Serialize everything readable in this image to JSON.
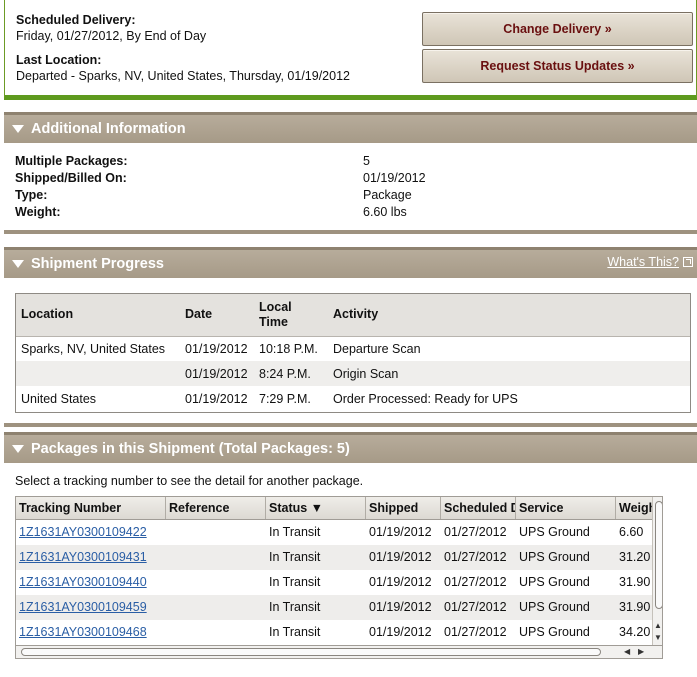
{
  "delivery": {
    "scheduled_label": "Scheduled Delivery:",
    "scheduled_value": "Friday, 01/27/2012, By End of Day",
    "last_location_label": "Last Location:",
    "last_location_value": "Departed - Sparks, NV, United States, Thursday, 01/19/2012",
    "change_button": "Change Delivery »",
    "request_button": "Request Status Updates »"
  },
  "additional_info": {
    "title": "Additional Information",
    "rows": [
      {
        "label": "Multiple Packages:",
        "value": "5"
      },
      {
        "label": "Shipped/Billed On:",
        "value": "01/19/2012"
      },
      {
        "label": "Type:",
        "value": "Package"
      },
      {
        "label": "Weight:",
        "value": "6.60 lbs"
      }
    ]
  },
  "progress": {
    "title": "Shipment Progress",
    "whats_this": "What's This?",
    "columns": [
      "Location",
      "Date",
      "Local Time",
      "Activity"
    ],
    "rows": [
      {
        "location": "Sparks, NV, United States",
        "date": "01/19/2012",
        "time": "10:18 P.M.",
        "activity": "Departure Scan"
      },
      {
        "location": "",
        "date": "01/19/2012",
        "time": "8:24 P.M.",
        "activity": "Origin Scan"
      },
      {
        "location": "United States",
        "date": "01/19/2012",
        "time": "7:29 P.M.",
        "activity": "Order Processed: Ready for UPS"
      }
    ]
  },
  "packages": {
    "title": "Packages in this Shipment (Total Packages: 5)",
    "note": "Select a tracking number to see the detail for another package.",
    "columns": [
      "Tracking Number",
      "Reference",
      "Status ▼",
      "Shipped",
      "Scheduled Delivery",
      "Service",
      "Weight"
    ],
    "rows": [
      {
        "tracking": "1Z1631AY0300109422",
        "reference": "",
        "status": "In Transit",
        "shipped": "01/19/2012",
        "scheduled": "01/27/2012",
        "service": "UPS Ground",
        "weight": "6.60"
      },
      {
        "tracking": "1Z1631AY0300109431",
        "reference": "",
        "status": "In Transit",
        "shipped": "01/19/2012",
        "scheduled": "01/27/2012",
        "service": "UPS Ground",
        "weight": "31.20"
      },
      {
        "tracking": "1Z1631AY0300109440",
        "reference": "",
        "status": "In Transit",
        "shipped": "01/19/2012",
        "scheduled": "01/27/2012",
        "service": "UPS Ground",
        "weight": "31.90"
      },
      {
        "tracking": "1Z1631AY0300109459",
        "reference": "",
        "status": "In Transit",
        "shipped": "01/19/2012",
        "scheduled": "01/27/2012",
        "service": "UPS Ground",
        "weight": "31.90"
      },
      {
        "tracking": "1Z1631AY0300109468",
        "reference": "",
        "status": "In Transit",
        "shipped": "01/19/2012",
        "scheduled": "01/27/2012",
        "service": "UPS Ground",
        "weight": "34.20"
      }
    ]
  },
  "colors": {
    "accent_green": "#5e9a1e",
    "header_tan": "#a69a87",
    "button_text": "#6a1010",
    "link": "#2a5ea5"
  },
  "icons": {
    "section_toggle": "triangle-down-icon",
    "external_link": "external-link-icon"
  }
}
